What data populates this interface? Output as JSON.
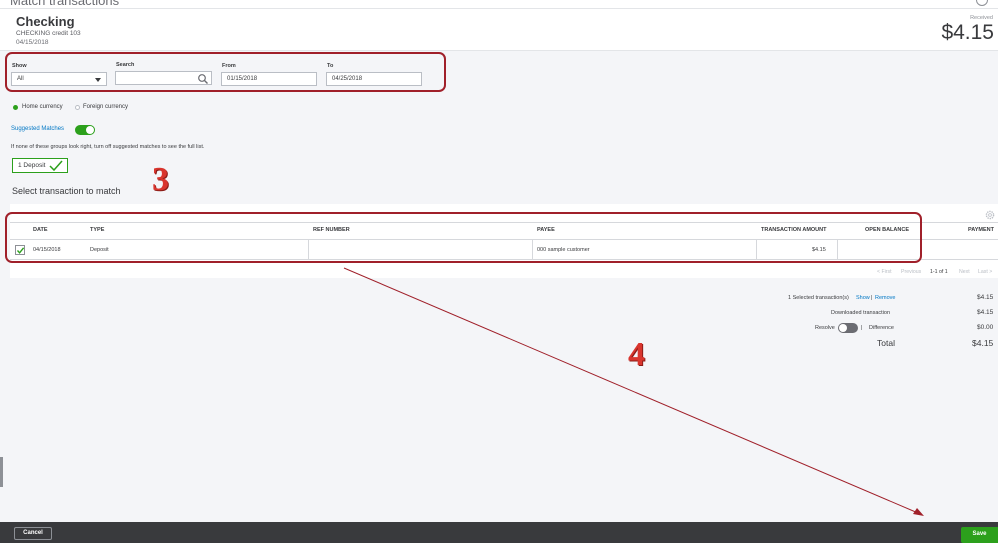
{
  "window": {
    "title": "Match transactions"
  },
  "header": {
    "account_name": "Checking",
    "account_sub": "CHECKING credit 103",
    "date": "04/15/2018",
    "received_label": "Received",
    "received_amount": "$4.15"
  },
  "filters": {
    "show_label": "Show",
    "show_value": "All",
    "search_label": "Search",
    "search_value": "",
    "from_label": "From",
    "from_value": "01/15/2018",
    "to_label": "To",
    "to_value": "04/25/2018"
  },
  "currency": {
    "home_label": "Home currency",
    "foreign_label": "Foreign currency",
    "selected": "home"
  },
  "suggested": {
    "label": "Suggested Matches",
    "enabled": true,
    "hint": "If none of these groups look right, turn off suggested matches to see the full list.",
    "chip_label": "1 Deposit"
  },
  "section_title": "Select transaction to match",
  "annotations": {
    "step3": "3",
    "step4": "4"
  },
  "table": {
    "headers": {
      "date": "DATE",
      "type": "TYPE",
      "ref": "REF NUMBER",
      "payee": "PAYEE",
      "amount": "TRANSACTION AMOUNT",
      "balance": "OPEN BALANCE",
      "payment": "PAYMENT"
    },
    "rows": [
      {
        "checked": true,
        "date": "04/15/2018",
        "type": "Deposit",
        "ref": "",
        "payee": "000 sample customer",
        "amount": "$4.15",
        "balance": "",
        "payment": ""
      }
    ]
  },
  "pagination": {
    "first": "< First",
    "previous": "Previous",
    "range": "1-1 of 1",
    "next": "Next",
    "last": "Last >"
  },
  "totals": {
    "selected_label": "1 Selected transaction(s)",
    "show_link": "Show",
    "separator": "|",
    "remove_link": "Remove",
    "selected_value": "$4.15",
    "downloaded_label": "Downloaded transaction",
    "downloaded_value": "$4.15",
    "resolve_label": "Resolve",
    "difference_label": "Difference",
    "difference_value": "$0.00",
    "total_label": "Total",
    "total_value": "$4.15"
  },
  "footer": {
    "cancel_label": "Cancel",
    "save_label": "Save"
  },
  "colors": {
    "accent_green": "#2ca01c",
    "annotation_red": "#a0202a",
    "footer_bg": "#393a3d",
    "link_blue": "#0077c5"
  }
}
